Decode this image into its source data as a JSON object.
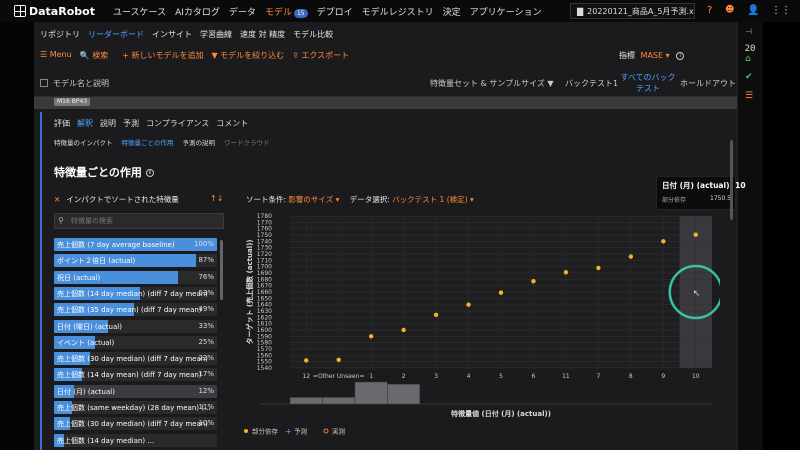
{
  "topbar": {
    "logo": "DataRobot",
    "nav": [
      "ユースケース",
      "AIカタログ",
      "データ",
      "モデル",
      "デプロイ",
      "モデルレジストリ",
      "決定",
      "アプリケーション"
    ],
    "nav_active": "モデル",
    "models_badge": "15",
    "file": "20220121_商品A_5月予測.xlsx"
  },
  "subnav": {
    "items": [
      "リポジトリ",
      "リーダーボード",
      "インサイト",
      "学習曲線",
      "速度 対 精度",
      "モデル比較"
    ],
    "active": "リーダーボード"
  },
  "toolbar": {
    "menu": "Menu",
    "search": "検索",
    "add_model": "新しいモデルを追加",
    "filter": "モデルを絞り込む",
    "export": "エクスポート",
    "metric_label": "指標",
    "metric_value": "MASE"
  },
  "leaderboard_header": {
    "model_name": "モデル名と説明",
    "feature_set": "特徴量セット & サンプルサイズ",
    "backtest1": "バックテスト1",
    "all_backtests": "すべてのバックテスト",
    "holdout": "ホールドアウト"
  },
  "model_tag": "M16 BP43",
  "tabs": [
    "評価",
    "解釈",
    "説明",
    "予測",
    "コンプライアンス",
    "コメント"
  ],
  "tab_active": "解釈",
  "subtabs": [
    "特徴量のインパクト",
    "特徴量ごとの作用",
    "予測の説明",
    "ワードクラウド"
  ],
  "subtab_active": "特徴量ごとの作用",
  "subtab_disabled": "ワードクラウド",
  "section_title": "特徴量ごとの作用",
  "impact_sort_label": "インパクトでソートされた特徴量",
  "search_placeholder": "特徴量の検索",
  "features": [
    {
      "name": "売上個数 (7 day average baseline)",
      "pct": "100%",
      "value": 100
    },
    {
      "name": "ポイント２倍日 (actual)",
      "pct": "87%",
      "value": 87
    },
    {
      "name": "祝日 (actual)",
      "pct": "76%",
      "value": 76
    },
    {
      "name": "売上個数 (14 day median) (diff 7 day mean)",
      "pct": "53%",
      "value": 53
    },
    {
      "name": "売上個数 (35 day mean) (diff 7 day mean)",
      "pct": "49%",
      "value": 49
    },
    {
      "name": "日付 (曜日) (actual)",
      "pct": "33%",
      "value": 33
    },
    {
      "name": "イベント (actual)",
      "pct": "25%",
      "value": 25
    },
    {
      "name": "売上個数 (30 day median) (diff 7 day mean)",
      "pct": "22%",
      "value": 22
    },
    {
      "name": "売上個数 (14 day mean) (diff 7 day mean)",
      "pct": "17%",
      "value": 17
    },
    {
      "name": "日付 (月) (actual)",
      "pct": "12%",
      "value": 12
    },
    {
      "name": "売上個数 (same weekday) (28 day mean) (...",
      "pct": "11%",
      "value": 11
    },
    {
      "name": "売上個数 (30 day median) (diff 7 day mean)",
      "pct": "10%",
      "value": 10
    },
    {
      "name": "売上個数 (14 day median) ...",
      "pct": "",
      "value": 6
    }
  ],
  "controls": {
    "sort_label": "ソート条件:",
    "sort_value": "影響のサイズ",
    "data_label": "データ選択:",
    "data_value": "バックテスト 1 (検定)"
  },
  "tooltip": {
    "title": "日付 (月) (actual): 10",
    "key": "部分依存",
    "value": "1750.5"
  },
  "right_rail": {
    "count": "20"
  },
  "chart_data": {
    "type": "scatter",
    "categories": [
      "12",
      "=Other Unseen=",
      "1",
      "2",
      "3",
      "4",
      "5",
      "6",
      "11",
      "7",
      "8",
      "9",
      "10"
    ],
    "series": [
      {
        "name": "部分依存",
        "values": [
          1552,
          1553,
          1590,
          1600,
          1624,
          1640,
          1659,
          1677,
          1691,
          1698,
          1716,
          1740,
          1750.5
        ],
        "color": "#f5b324"
      }
    ],
    "histogram": [
      {
        "category": "12",
        "value": 0.3
      },
      {
        "category": "=Other Unseen=",
        "value": 0.3
      },
      {
        "category": "1",
        "value": 1.0
      },
      {
        "category": "2",
        "value": 0.9
      }
    ],
    "ylim": [
      1540,
      1780
    ],
    "yticks": [
      1540,
      1550,
      1560,
      1570,
      1580,
      1590,
      1600,
      1610,
      1620,
      1630,
      1640,
      1650,
      1660,
      1670,
      1680,
      1690,
      1700,
      1710,
      1720,
      1730,
      1740,
      1750,
      1760,
      1770,
      1780
    ],
    "ylabel": "ターゲット (売上個数 (actual))",
    "xlabel": "特徴量値 (日付 (月) (actual))",
    "legend": [
      "部分依存",
      "予測",
      "実測"
    ],
    "legend_colors": [
      "#f5b324",
      "#4da3ff",
      "#ff7a33"
    ],
    "legend_markers": [
      "dot",
      "plus",
      "ring"
    ],
    "highlight_category": "10",
    "grid": true
  }
}
